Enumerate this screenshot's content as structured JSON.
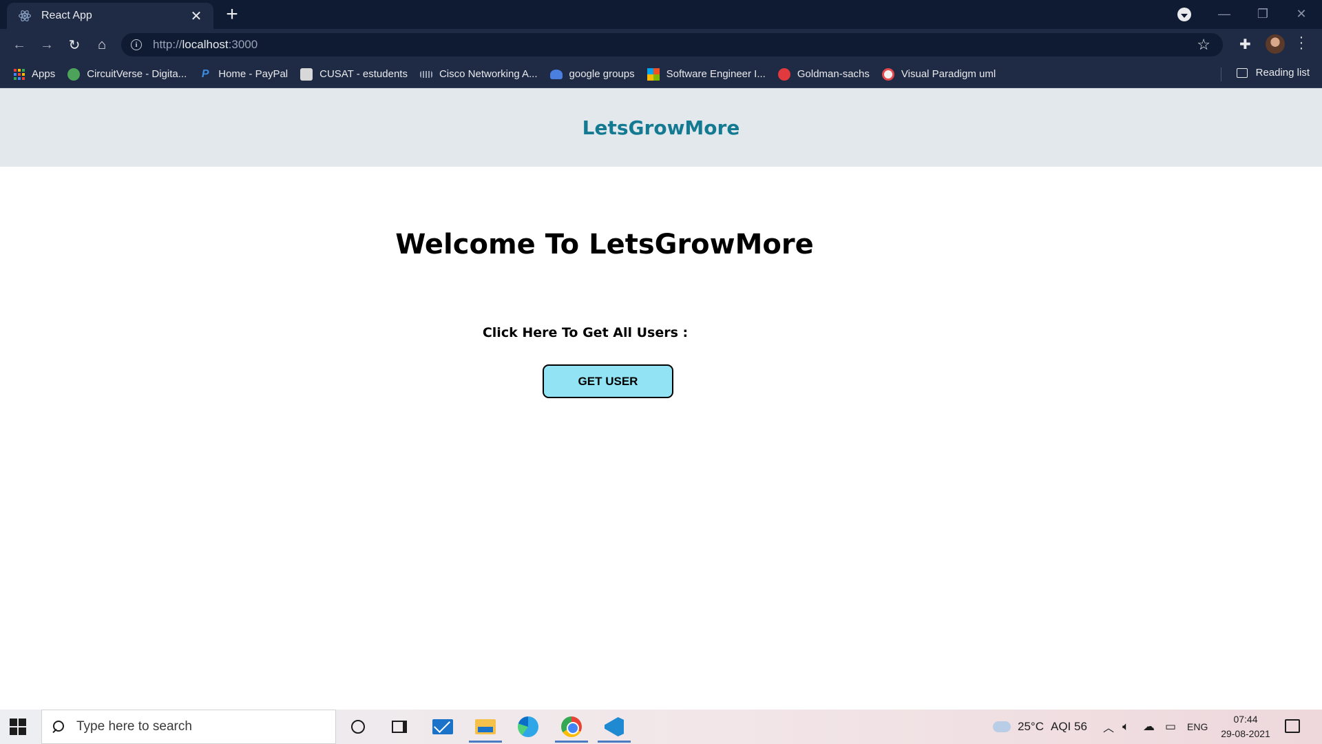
{
  "browser": {
    "tab_title": "React App",
    "tab_close": "✕",
    "new_tab": "+",
    "url_scheme": "http://",
    "url_host": "localhost",
    "url_port": ":3000",
    "window_controls": {
      "minimize": "—",
      "restore": "❐",
      "close": "✕"
    }
  },
  "bookmarks": {
    "items": [
      {
        "label": "Apps"
      },
      {
        "label": "CircuitVerse - Digita..."
      },
      {
        "label": "Home - PayPal"
      },
      {
        "label": "CUSAT - estudents"
      },
      {
        "label": "Cisco Networking A..."
      },
      {
        "label": "google groups"
      },
      {
        "label": "Software Engineer I..."
      },
      {
        "label": "Goldman-sachs"
      },
      {
        "label": "Visual Paradigm uml"
      }
    ],
    "reading_list": "Reading list"
  },
  "page": {
    "brand": "LetsGrowMore",
    "heading": "Welcome To LetsGrowMore",
    "prompt": "Click Here To Get All Users :",
    "button_label": "GET USER"
  },
  "taskbar": {
    "search_placeholder": "Type here to search",
    "temperature": "25°C",
    "aqi": "AQI 56",
    "language": "ENG",
    "time": "07:44",
    "date": "29-08-2021"
  },
  "colors": {
    "brand": "#147a92",
    "header_bg": "#e2e8ec",
    "button_bg": "#92e3f4",
    "browser_frame": "#1f2a44"
  },
  "icons": [
    "react-logo-icon",
    "close-icon",
    "plus-icon",
    "back-arrow-icon",
    "forward-arrow-icon",
    "reload-icon",
    "home-icon",
    "info-icon",
    "star-icon",
    "extensions-icon",
    "profile-avatar",
    "more-menu-icon",
    "reading-list-icon",
    "windows-start-icon",
    "search-icon",
    "cortana-icon",
    "task-view-icon",
    "mail-icon",
    "file-explorer-icon",
    "edge-icon",
    "chrome-icon",
    "vscode-icon",
    "weather-icon",
    "chevron-up-icon",
    "volume-icon",
    "onedrive-icon",
    "battery-icon",
    "notification-icon"
  ]
}
